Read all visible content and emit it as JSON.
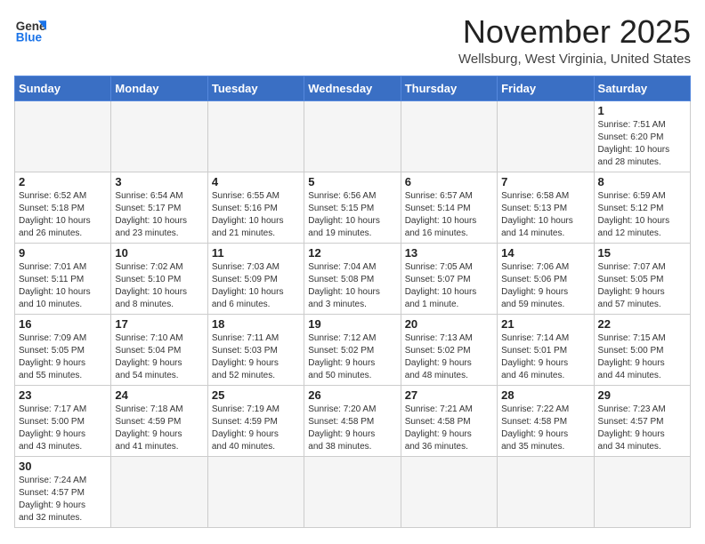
{
  "logo": {
    "line1": "General",
    "line2": "Blue"
  },
  "title": "November 2025",
  "subtitle": "Wellsburg, West Virginia, United States",
  "weekdays": [
    "Sunday",
    "Monday",
    "Tuesday",
    "Wednesday",
    "Thursday",
    "Friday",
    "Saturday"
  ],
  "weeks": [
    [
      {
        "day": "",
        "info": ""
      },
      {
        "day": "",
        "info": ""
      },
      {
        "day": "",
        "info": ""
      },
      {
        "day": "",
        "info": ""
      },
      {
        "day": "",
        "info": ""
      },
      {
        "day": "",
        "info": ""
      },
      {
        "day": "1",
        "info": "Sunrise: 7:51 AM\nSunset: 6:20 PM\nDaylight: 10 hours\nand 28 minutes."
      }
    ],
    [
      {
        "day": "2",
        "info": "Sunrise: 6:52 AM\nSunset: 5:18 PM\nDaylight: 10 hours\nand 26 minutes."
      },
      {
        "day": "3",
        "info": "Sunrise: 6:54 AM\nSunset: 5:17 PM\nDaylight: 10 hours\nand 23 minutes."
      },
      {
        "day": "4",
        "info": "Sunrise: 6:55 AM\nSunset: 5:16 PM\nDaylight: 10 hours\nand 21 minutes."
      },
      {
        "day": "5",
        "info": "Sunrise: 6:56 AM\nSunset: 5:15 PM\nDaylight: 10 hours\nand 19 minutes."
      },
      {
        "day": "6",
        "info": "Sunrise: 6:57 AM\nSunset: 5:14 PM\nDaylight: 10 hours\nand 16 minutes."
      },
      {
        "day": "7",
        "info": "Sunrise: 6:58 AM\nSunset: 5:13 PM\nDaylight: 10 hours\nand 14 minutes."
      },
      {
        "day": "8",
        "info": "Sunrise: 6:59 AM\nSunset: 5:12 PM\nDaylight: 10 hours\nand 12 minutes."
      }
    ],
    [
      {
        "day": "9",
        "info": "Sunrise: 7:01 AM\nSunset: 5:11 PM\nDaylight: 10 hours\nand 10 minutes."
      },
      {
        "day": "10",
        "info": "Sunrise: 7:02 AM\nSunset: 5:10 PM\nDaylight: 10 hours\nand 8 minutes."
      },
      {
        "day": "11",
        "info": "Sunrise: 7:03 AM\nSunset: 5:09 PM\nDaylight: 10 hours\nand 6 minutes."
      },
      {
        "day": "12",
        "info": "Sunrise: 7:04 AM\nSunset: 5:08 PM\nDaylight: 10 hours\nand 3 minutes."
      },
      {
        "day": "13",
        "info": "Sunrise: 7:05 AM\nSunset: 5:07 PM\nDaylight: 10 hours\nand 1 minute."
      },
      {
        "day": "14",
        "info": "Sunrise: 7:06 AM\nSunset: 5:06 PM\nDaylight: 9 hours\nand 59 minutes."
      },
      {
        "day": "15",
        "info": "Sunrise: 7:07 AM\nSunset: 5:05 PM\nDaylight: 9 hours\nand 57 minutes."
      }
    ],
    [
      {
        "day": "16",
        "info": "Sunrise: 7:09 AM\nSunset: 5:05 PM\nDaylight: 9 hours\nand 55 minutes."
      },
      {
        "day": "17",
        "info": "Sunrise: 7:10 AM\nSunset: 5:04 PM\nDaylight: 9 hours\nand 54 minutes."
      },
      {
        "day": "18",
        "info": "Sunrise: 7:11 AM\nSunset: 5:03 PM\nDaylight: 9 hours\nand 52 minutes."
      },
      {
        "day": "19",
        "info": "Sunrise: 7:12 AM\nSunset: 5:02 PM\nDaylight: 9 hours\nand 50 minutes."
      },
      {
        "day": "20",
        "info": "Sunrise: 7:13 AM\nSunset: 5:02 PM\nDaylight: 9 hours\nand 48 minutes."
      },
      {
        "day": "21",
        "info": "Sunrise: 7:14 AM\nSunset: 5:01 PM\nDaylight: 9 hours\nand 46 minutes."
      },
      {
        "day": "22",
        "info": "Sunrise: 7:15 AM\nSunset: 5:00 PM\nDaylight: 9 hours\nand 44 minutes."
      }
    ],
    [
      {
        "day": "23",
        "info": "Sunrise: 7:17 AM\nSunset: 5:00 PM\nDaylight: 9 hours\nand 43 minutes."
      },
      {
        "day": "24",
        "info": "Sunrise: 7:18 AM\nSunset: 4:59 PM\nDaylight: 9 hours\nand 41 minutes."
      },
      {
        "day": "25",
        "info": "Sunrise: 7:19 AM\nSunset: 4:59 PM\nDaylight: 9 hours\nand 40 minutes."
      },
      {
        "day": "26",
        "info": "Sunrise: 7:20 AM\nSunset: 4:58 PM\nDaylight: 9 hours\nand 38 minutes."
      },
      {
        "day": "27",
        "info": "Sunrise: 7:21 AM\nSunset: 4:58 PM\nDaylight: 9 hours\nand 36 minutes."
      },
      {
        "day": "28",
        "info": "Sunrise: 7:22 AM\nSunset: 4:58 PM\nDaylight: 9 hours\nand 35 minutes."
      },
      {
        "day": "29",
        "info": "Sunrise: 7:23 AM\nSunset: 4:57 PM\nDaylight: 9 hours\nand 34 minutes."
      }
    ],
    [
      {
        "day": "30",
        "info": "Sunrise: 7:24 AM\nSunset: 4:57 PM\nDaylight: 9 hours\nand 32 minutes."
      },
      {
        "day": "",
        "info": ""
      },
      {
        "day": "",
        "info": ""
      },
      {
        "day": "",
        "info": ""
      },
      {
        "day": "",
        "info": ""
      },
      {
        "day": "",
        "info": ""
      },
      {
        "day": "",
        "info": ""
      }
    ]
  ]
}
